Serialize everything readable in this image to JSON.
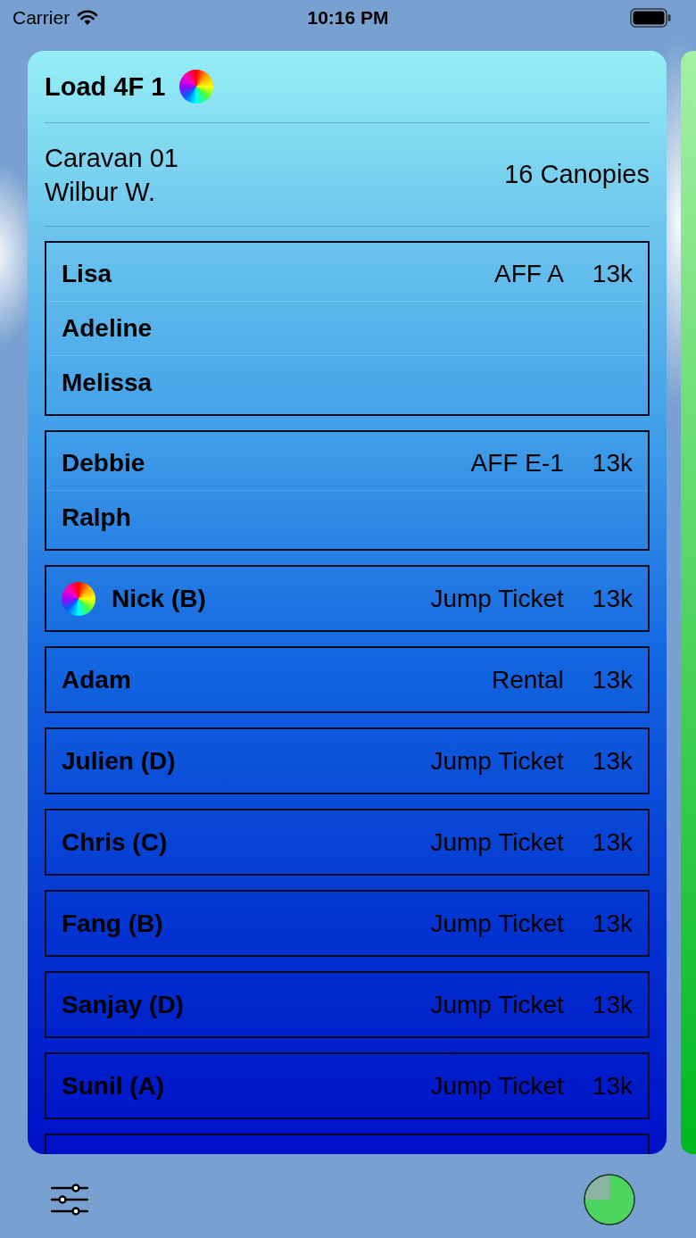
{
  "status_bar": {
    "carrier": "Carrier",
    "time": "10:16 PM"
  },
  "load": {
    "title": "Load 4F 1",
    "aircraft": "Caravan 01",
    "pilot": "Wilbur W.",
    "canopies": "16 Canopies",
    "groups": [
      {
        "jumpers": [
          {
            "name": "Lisa",
            "jump_type": "AFF A",
            "altitude": "13k",
            "color_wheel": false
          },
          {
            "name": "Adeline",
            "color_wheel": false
          },
          {
            "name": "Melissa",
            "color_wheel": false
          }
        ]
      },
      {
        "jumpers": [
          {
            "name": "Debbie",
            "jump_type": "AFF E-1",
            "altitude": "13k",
            "color_wheel": false
          },
          {
            "name": "Ralph",
            "color_wheel": false
          }
        ]
      },
      {
        "jumpers": [
          {
            "name": "Nick (B)",
            "jump_type": "Jump Ticket",
            "altitude": "13k",
            "color_wheel": true
          }
        ]
      },
      {
        "jumpers": [
          {
            "name": "Adam",
            "jump_type": "Rental",
            "altitude": "13k",
            "color_wheel": false
          }
        ]
      },
      {
        "jumpers": [
          {
            "name": "Julien (D)",
            "jump_type": "Jump Ticket",
            "altitude": "13k",
            "color_wheel": false
          }
        ]
      },
      {
        "jumpers": [
          {
            "name": "Chris (C)",
            "jump_type": "Jump Ticket",
            "altitude": "13k",
            "color_wheel": false
          }
        ]
      },
      {
        "jumpers": [
          {
            "name": "Fang (B)",
            "jump_type": "Jump Ticket",
            "altitude": "13k",
            "color_wheel": false
          }
        ]
      },
      {
        "jumpers": [
          {
            "name": "Sanjay (D)",
            "jump_type": "Jump Ticket",
            "altitude": "13k",
            "color_wheel": false
          }
        ]
      },
      {
        "jumpers": [
          {
            "name": "Sunil (A)",
            "jump_type": "Jump Ticket",
            "altitude": "13k",
            "color_wheel": false
          }
        ]
      }
    ]
  }
}
